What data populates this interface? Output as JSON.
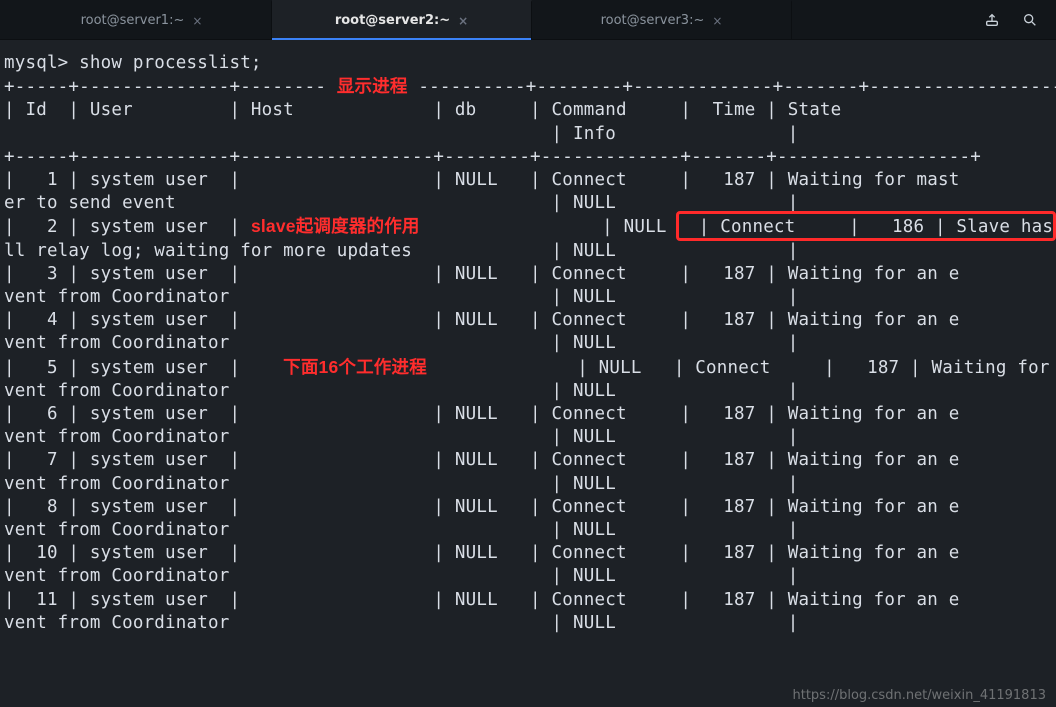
{
  "tabs": [
    {
      "label": "root@server1:~"
    },
    {
      "label": "root@server2:~"
    },
    {
      "label": "root@server3:~"
    }
  ],
  "active_tab_index": 1,
  "toolbar": {
    "upload_icon": "upload-icon",
    "search_icon": "search-icon"
  },
  "prompt": "mysql> show processlist;",
  "annotations": {
    "a1": "显示进程",
    "a2": "slave起调度器的作用",
    "a3": "下面16个工作进程"
  },
  "headers": {
    "Id": "Id",
    "User": "User",
    "Host": "Host",
    "db": "db",
    "Command": "Command",
    "Info": "Info",
    "Time": "Time",
    "State": "State"
  },
  "rows": [
    {
      "Id": "1",
      "User": "system user",
      "Host": "",
      "db": "NULL",
      "Command": "Connect",
      "Time": "187",
      "State": "Waiting for mast",
      "StateWrap": "er to send event",
      "Info": "NULL"
    },
    {
      "Id": "2",
      "User": "system user",
      "Host": "",
      "db": "NULL",
      "Command": "Connect",
      "Time": "186",
      "State": "Slave has read a",
      "StateWrap": "ll relay log; waiting for more updates",
      "Info": "NULL"
    },
    {
      "Id": "3",
      "User": "system user",
      "Host": "",
      "db": "NULL",
      "Command": "Connect",
      "Time": "187",
      "State": "Waiting for an e",
      "StateWrap": "vent from Coordinator",
      "Info": "NULL"
    },
    {
      "Id": "4",
      "User": "system user",
      "Host": "",
      "db": "NULL",
      "Command": "Connect",
      "Time": "187",
      "State": "Waiting for an e",
      "StateWrap": "vent from Coordinator",
      "Info": "NULL"
    },
    {
      "Id": "5",
      "User": "system user",
      "Host": "",
      "db": "NULL",
      "Command": "Connect",
      "Time": "187",
      "State": "Waiting for an e",
      "StateWrap": "vent from Coordinator",
      "Info": "NULL"
    },
    {
      "Id": "6",
      "User": "system user",
      "Host": "",
      "db": "NULL",
      "Command": "Connect",
      "Time": "187",
      "State": "Waiting for an e",
      "StateWrap": "vent from Coordinator",
      "Info": "NULL"
    },
    {
      "Id": "7",
      "User": "system user",
      "Host": "",
      "db": "NULL",
      "Command": "Connect",
      "Time": "187",
      "State": "Waiting for an e",
      "StateWrap": "vent from Coordinator",
      "Info": "NULL"
    },
    {
      "Id": "8",
      "User": "system user",
      "Host": "",
      "db": "NULL",
      "Command": "Connect",
      "Time": "187",
      "State": "Waiting for an e",
      "StateWrap": "vent from Coordinator",
      "Info": "NULL"
    },
    {
      "Id": "10",
      "User": "system user",
      "Host": "",
      "db": "NULL",
      "Command": "Connect",
      "Time": "187",
      "State": "Waiting for an e",
      "StateWrap": "vent from Coordinator",
      "Info": "NULL"
    },
    {
      "Id": "11",
      "User": "system user",
      "Host": "",
      "db": "NULL",
      "Command": "Connect",
      "Time": "187",
      "State": "Waiting for an e",
      "StateWrap": "vent from Coordinator",
      "Info": "NULL"
    }
  ],
  "highlight_row_index": 1,
  "watermark": "https://blog.csdn.net/weixin_41191813"
}
